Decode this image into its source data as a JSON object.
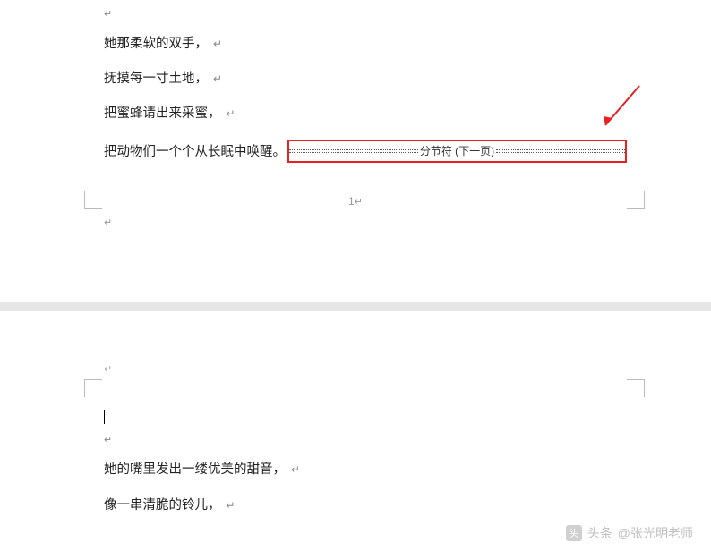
{
  "page1": {
    "top_mark": "↵",
    "lines": [
      "她那柔软的双手，",
      "抚摸每一寸土地，",
      "把蜜蜂请出来采蜜，"
    ],
    "break_prefix": "把动物们一个个从长眠中唤醒。",
    "break_label": "分节符 (下一页)",
    "page_number": "1",
    "footer_mark": "↵"
  },
  "page2": {
    "header_mark": "↵",
    "cursor_para": "",
    "blank_mark": "↵",
    "lines": [
      "她的嘴里发出一缕优美的甜音，",
      "像一串清脆的铃儿，"
    ]
  },
  "watermark": {
    "prefix": "头条",
    "author": "@张光明老师"
  },
  "marks": {
    "line_end": "↵"
  }
}
